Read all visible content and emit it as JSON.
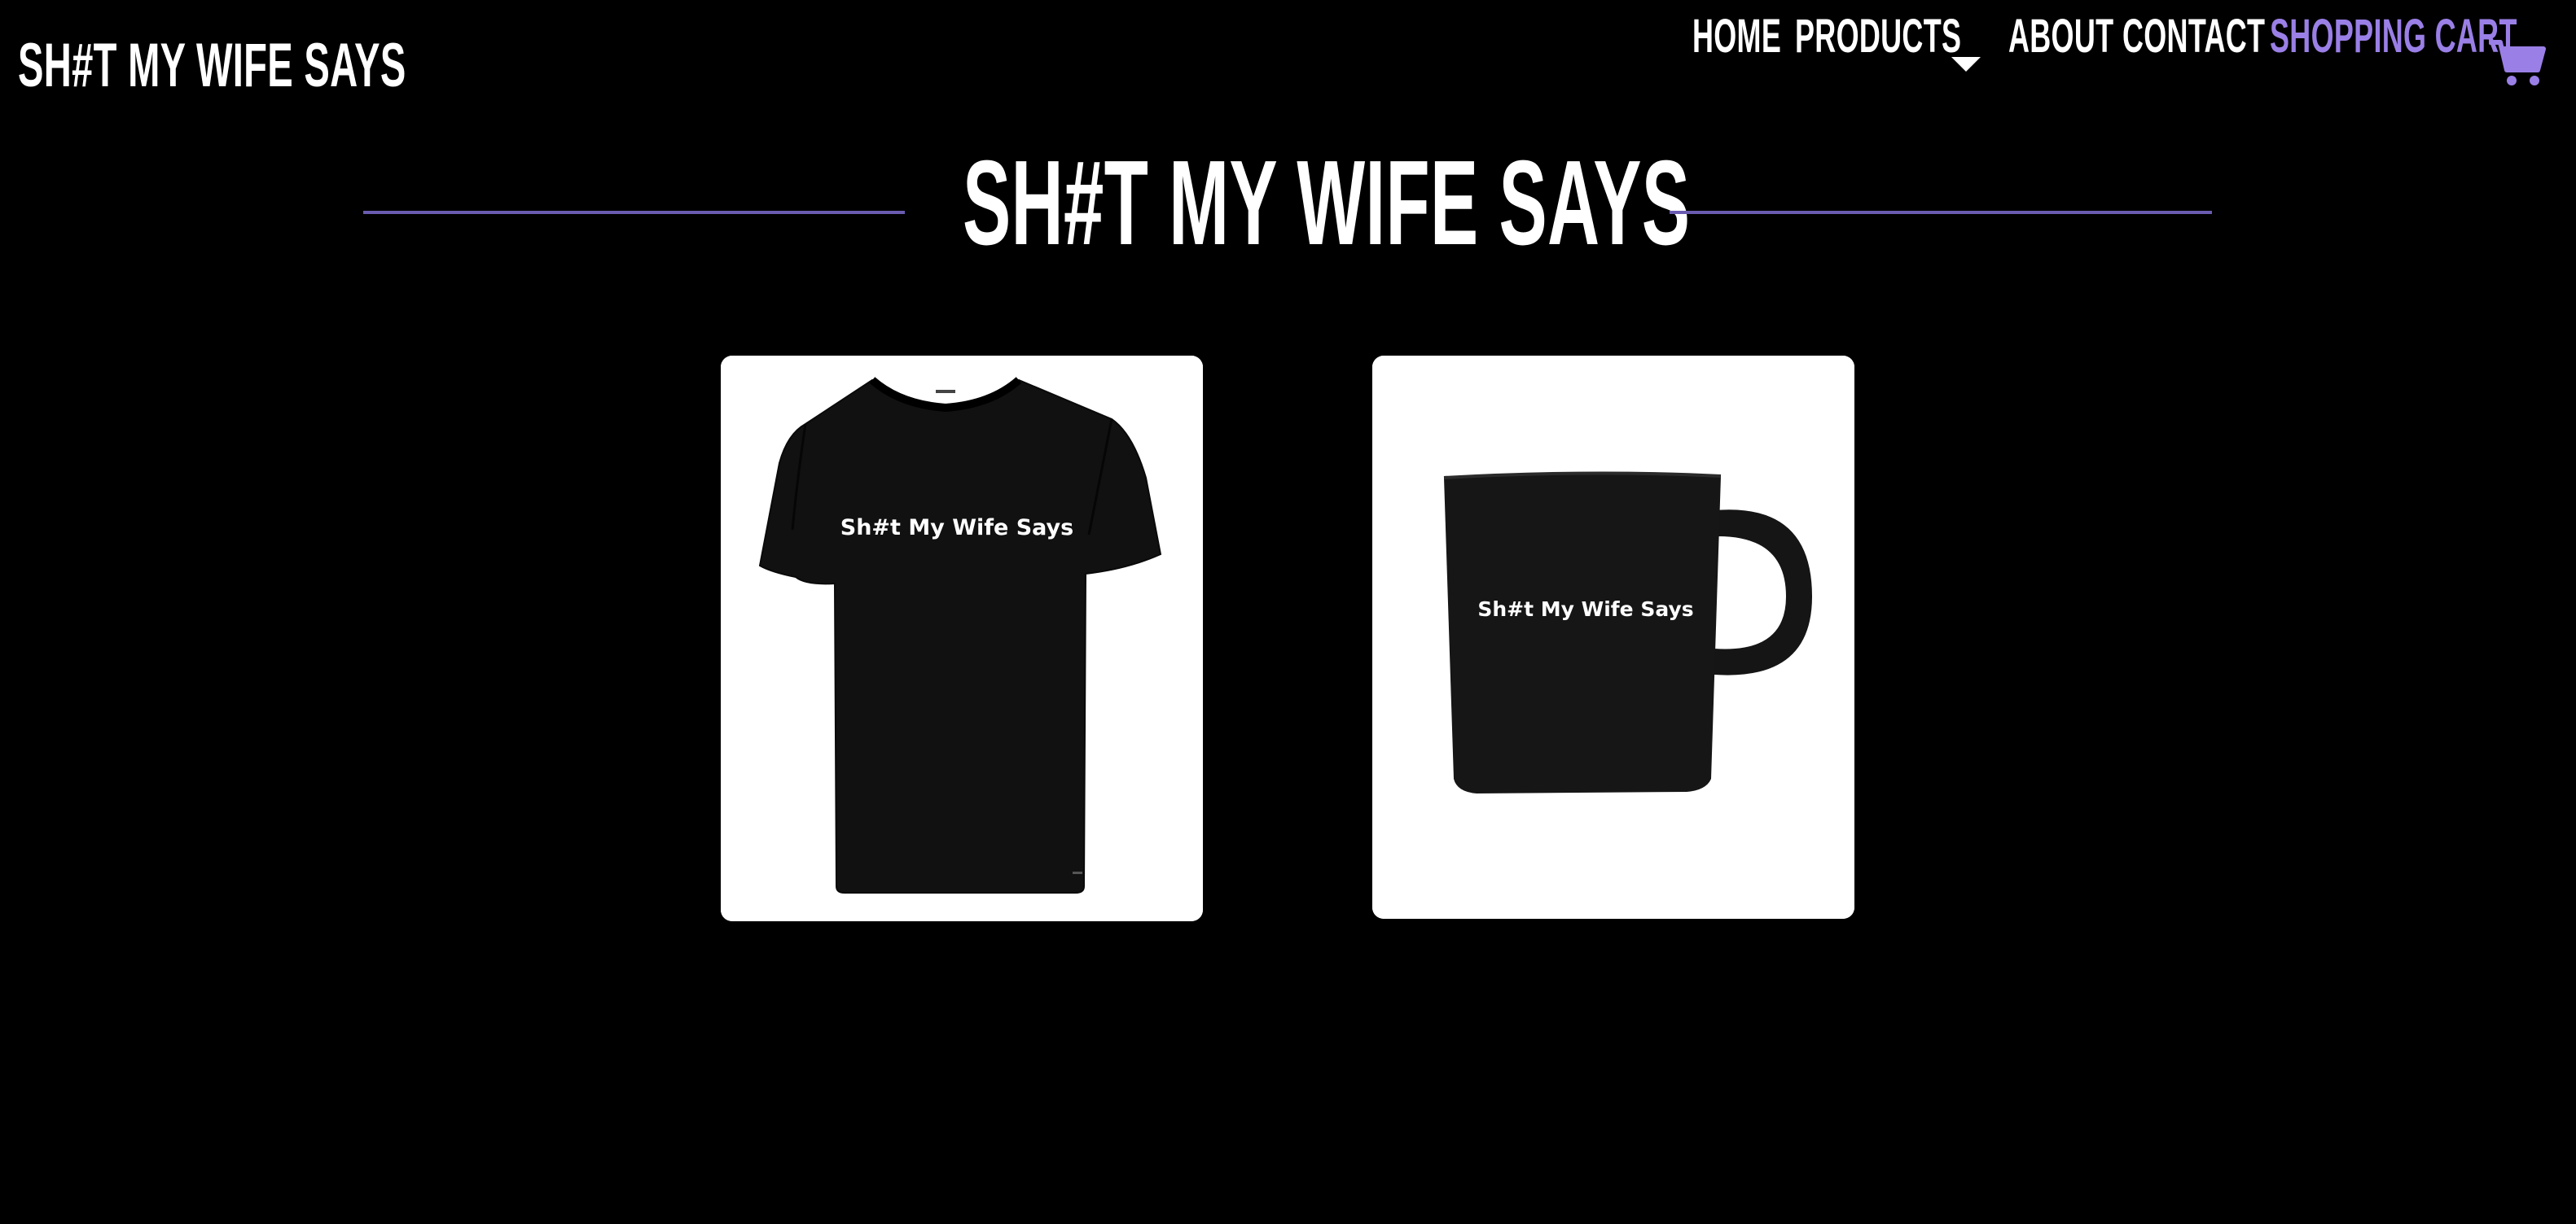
{
  "brand": {
    "name": "SH#T MY WIFE SAYS"
  },
  "nav": {
    "home": "HOME",
    "products": "PRODUCTS",
    "about": "ABOUT",
    "contact": "CONTACT",
    "cart": "SHOPPING CART"
  },
  "hero": {
    "title": "SH#T MY WIFE SAYS"
  },
  "products": [
    {
      "name": "t-shirt",
      "print": "Sh#t My Wife Says",
      "icon": "tshirt-image"
    },
    {
      "name": "mug",
      "print": "Sh#t My Wife Says",
      "icon": "mug-image"
    }
  ],
  "colors": {
    "background": "#000000",
    "text": "#ffffff",
    "accent": "#9a7fe6",
    "divider": "#6a5bb0",
    "card": "#ffffff"
  }
}
